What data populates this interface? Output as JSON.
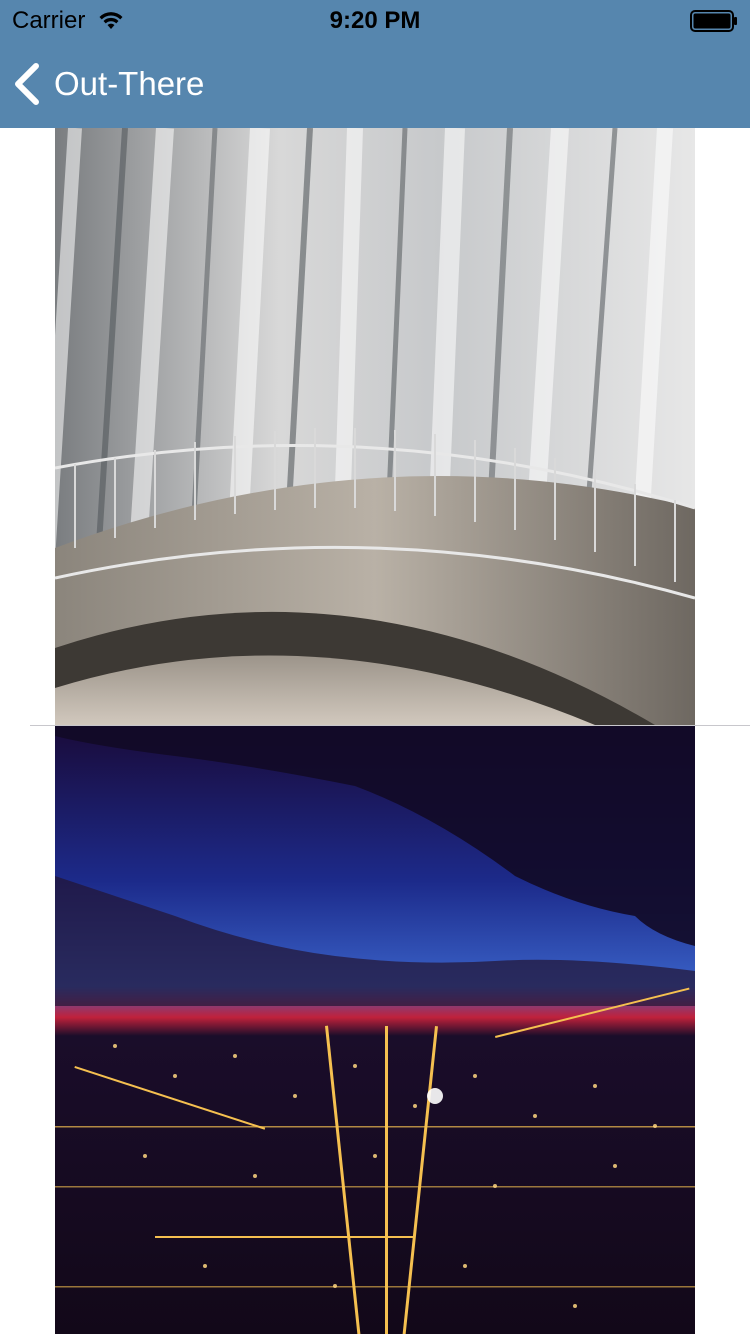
{
  "status_bar": {
    "carrier": "Carrier",
    "time": "9:20 PM",
    "wifi_icon": "wifi-icon",
    "battery_icon": "battery-icon"
  },
  "nav": {
    "back_label": "Out-There",
    "back_icon": "chevron-left-icon",
    "background_color": "#5686ae"
  },
  "feed": {
    "photos": [
      {
        "description_icon": "photo-staircase-curtains"
      },
      {
        "description_icon": "photo-night-city-skyline"
      }
    ]
  }
}
